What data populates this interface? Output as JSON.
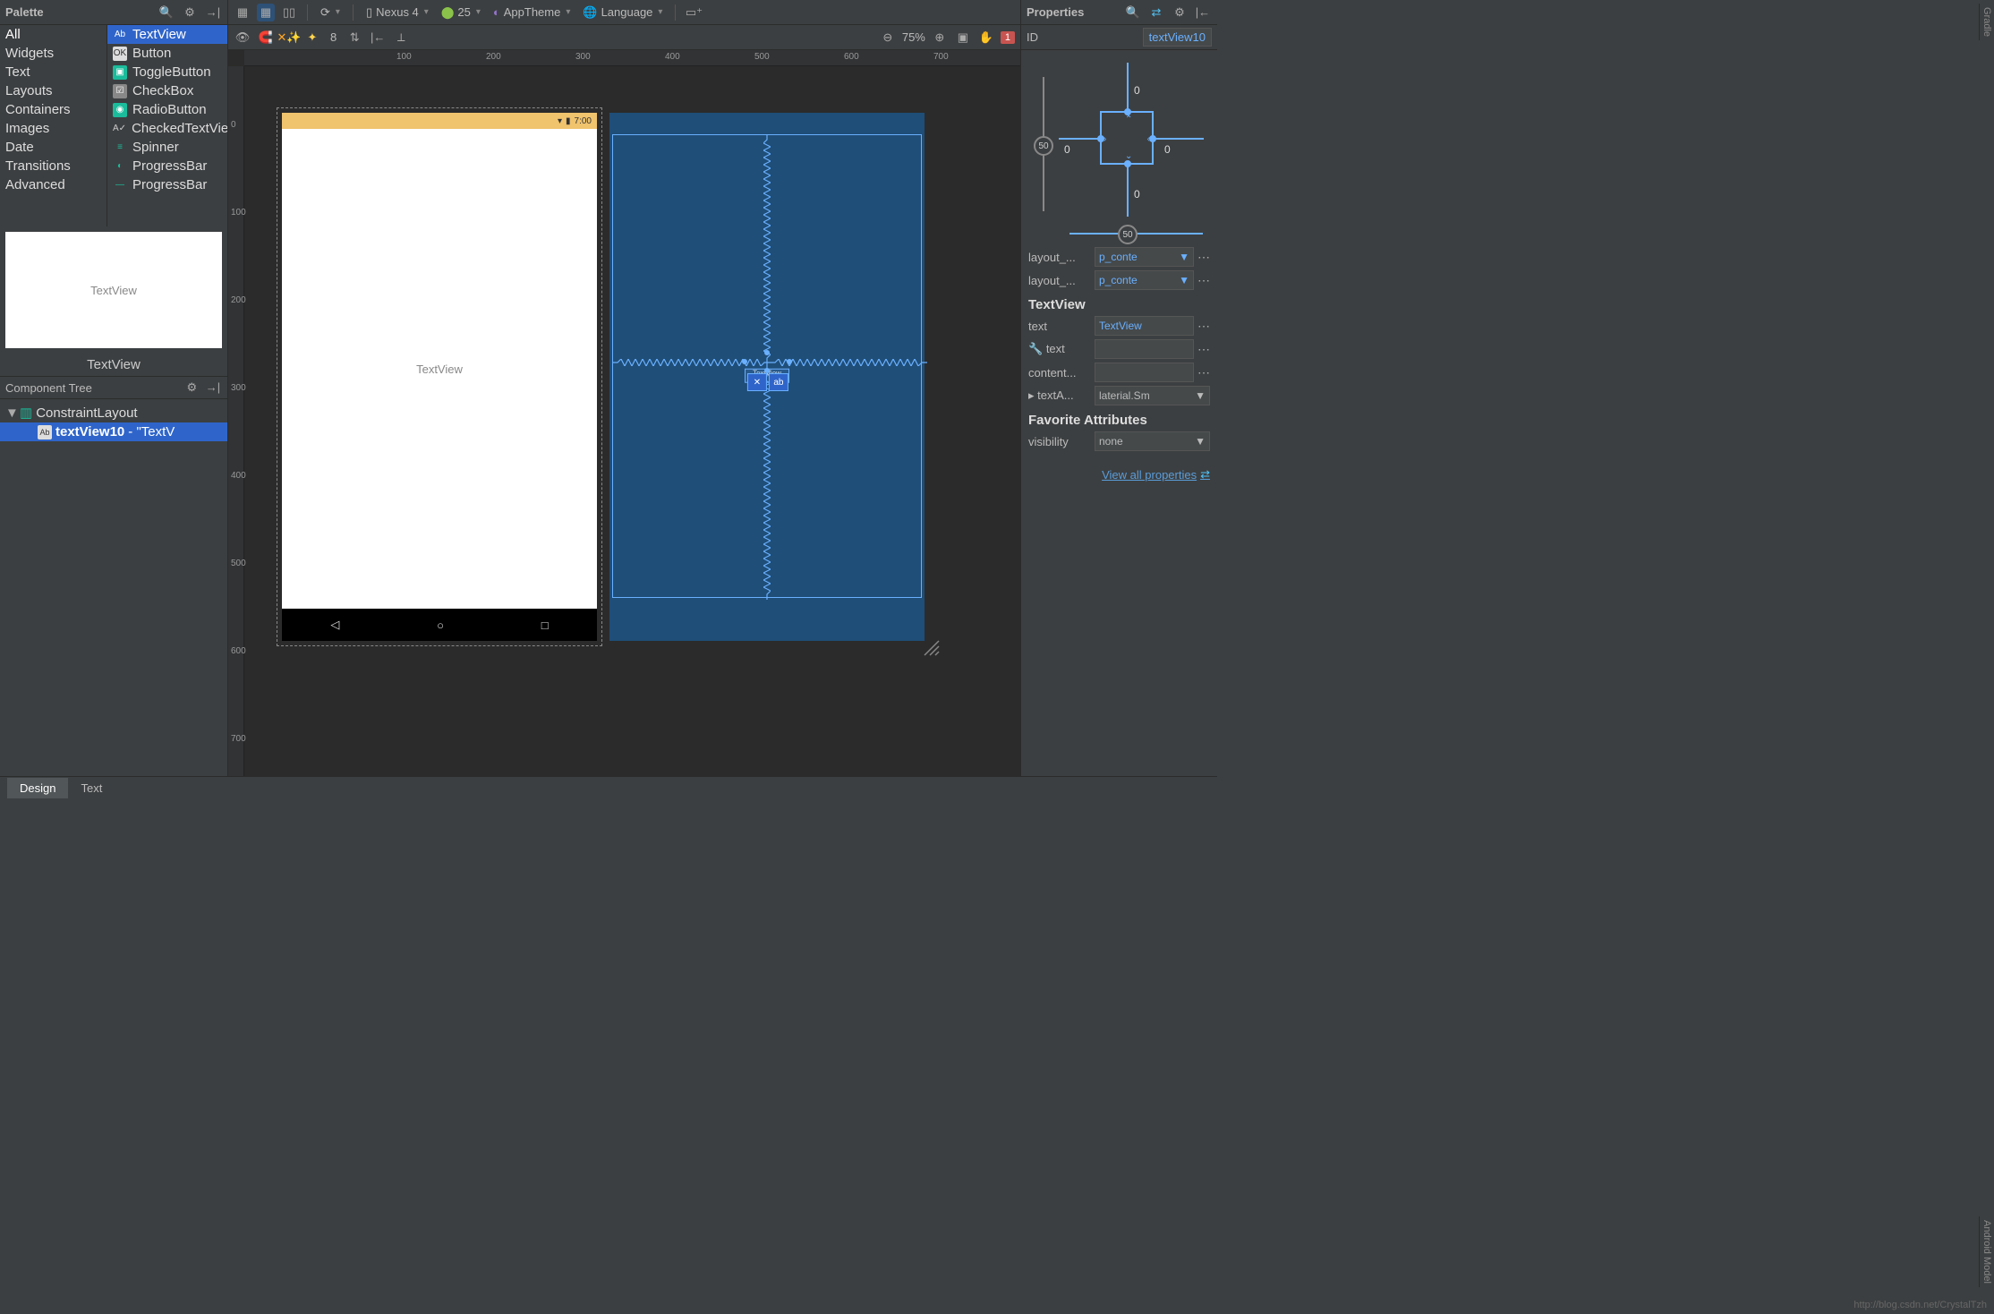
{
  "palette": {
    "title": "Palette",
    "categories": [
      "All",
      "Widgets",
      "Text",
      "Layouts",
      "Containers",
      "Images",
      "Date",
      "Transitions",
      "Advanced"
    ],
    "items": [
      {
        "icon": "Ab",
        "iconBg": "#2f65ca",
        "iconFg": "#fff",
        "label": "TextView",
        "selected": true
      },
      {
        "icon": "OK",
        "iconBg": "#ddd",
        "iconFg": "#333",
        "label": "Button"
      },
      {
        "icon": "▣",
        "iconBg": "#1abc9c",
        "iconFg": "#fff",
        "label": "ToggleButton"
      },
      {
        "icon": "☑",
        "iconBg": "#888",
        "iconFg": "#fff",
        "label": "CheckBox"
      },
      {
        "icon": "◉",
        "iconBg": "#1abc9c",
        "iconFg": "#fff",
        "label": "RadioButton"
      },
      {
        "icon": "A✓",
        "iconBg": "transparent",
        "iconFg": "#ccc",
        "label": "CheckedTextView"
      },
      {
        "icon": "≡",
        "iconBg": "transparent",
        "iconFg": "#1abc9c",
        "label": "Spinner"
      },
      {
        "icon": "◐",
        "iconBg": "transparent",
        "iconFg": "#1abc9c",
        "label": "ProgressBar"
      },
      {
        "icon": "—",
        "iconBg": "transparent",
        "iconFg": "#1abc9c",
        "label": "ProgressBar"
      }
    ],
    "preview_text": "TextView",
    "preview_name": "TextView"
  },
  "component_tree": {
    "title": "Component Tree",
    "root": "ConstraintLayout",
    "child_id": "textView10",
    "child_suffix": " - \"TextV"
  },
  "top_toolbar": {
    "device": "Nexus 4",
    "api": "25",
    "theme": "AppTheme",
    "locale": "Language"
  },
  "design_toolbar": {
    "autoconnect_num": "8",
    "zoom": "75%",
    "warnings": "1"
  },
  "device_preview": {
    "status_time": "7:00",
    "label": "TextView"
  },
  "blueprint": {
    "sel_label": "TextView"
  },
  "ruler_h": [
    "100",
    "200",
    "300",
    "400",
    "500",
    "600",
    "700"
  ],
  "ruler_v": [
    "0",
    "100",
    "200",
    "300",
    "400",
    "500",
    "600",
    "700"
  ],
  "properties": {
    "title": "Properties",
    "id_label": "ID",
    "id_value": "textView10",
    "constraints": {
      "top": "0",
      "bottom": "0",
      "left": "0",
      "right": "0",
      "bias_v": "50",
      "bias_h": "50"
    },
    "layout_width_label": "layout_...",
    "layout_width_value": "p_conte",
    "layout_height_label": "layout_...",
    "layout_height_value": "p_conte",
    "section": "TextView",
    "text_label": "text",
    "text_value": "TextView",
    "tools_text_label": "text",
    "content_label": "content...",
    "textapp_label": "textA...",
    "textapp_value": "laterial.Sm",
    "fav_section": "Favorite Attributes",
    "visibility_label": "visibility",
    "visibility_value": "none",
    "view_all": "View all properties"
  },
  "bottom_tabs": {
    "design": "Design",
    "text": "Text"
  },
  "edge_labels": {
    "gradle": "Gradle",
    "model": "Android Model"
  },
  "watermark": "http://blog.csdn.net/CrystalTzh"
}
